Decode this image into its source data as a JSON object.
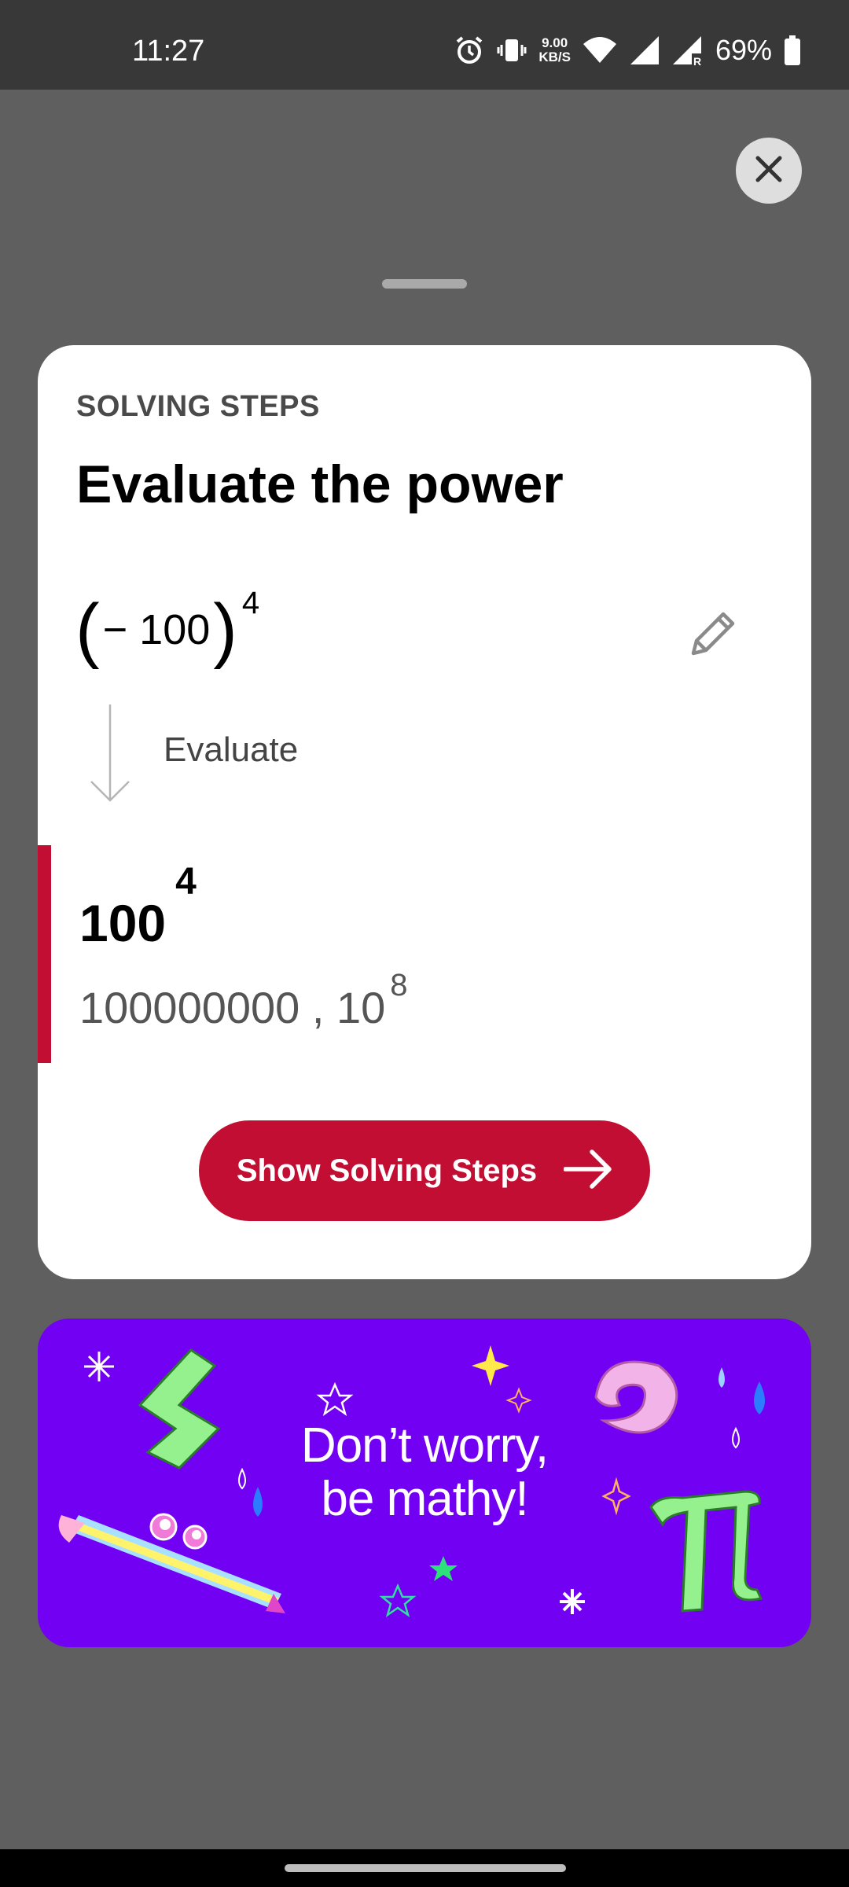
{
  "status_bar": {
    "time": "11:27",
    "net_speed_value": "9.00",
    "net_speed_unit": "KB/S",
    "battery_percent": "69%",
    "icons": [
      "alarm-icon",
      "vibrate-icon",
      "wifi-icon",
      "signal-icon",
      "signal-roaming-icon",
      "battery-icon"
    ]
  },
  "overlay": {
    "close_icon": "close-icon"
  },
  "card": {
    "section_label": "SOLVING STEPS",
    "title": "Evaluate the power",
    "expression": {
      "open_paren": "(",
      "inner": "− 100",
      "close_paren": ")",
      "exponent": "4"
    },
    "edit_icon": "pencil-icon",
    "step_label": "Evaluate",
    "result": {
      "base": "100",
      "exponent": "4"
    },
    "alt_result": {
      "text": "100000000 , 10",
      "exponent": "8"
    },
    "cta_label": "Show Solving Steps",
    "accent_color": "#c20e33"
  },
  "banner": {
    "line1": "Don’t worry,",
    "line2": "be mathy!",
    "background_color": "#7200f2"
  }
}
